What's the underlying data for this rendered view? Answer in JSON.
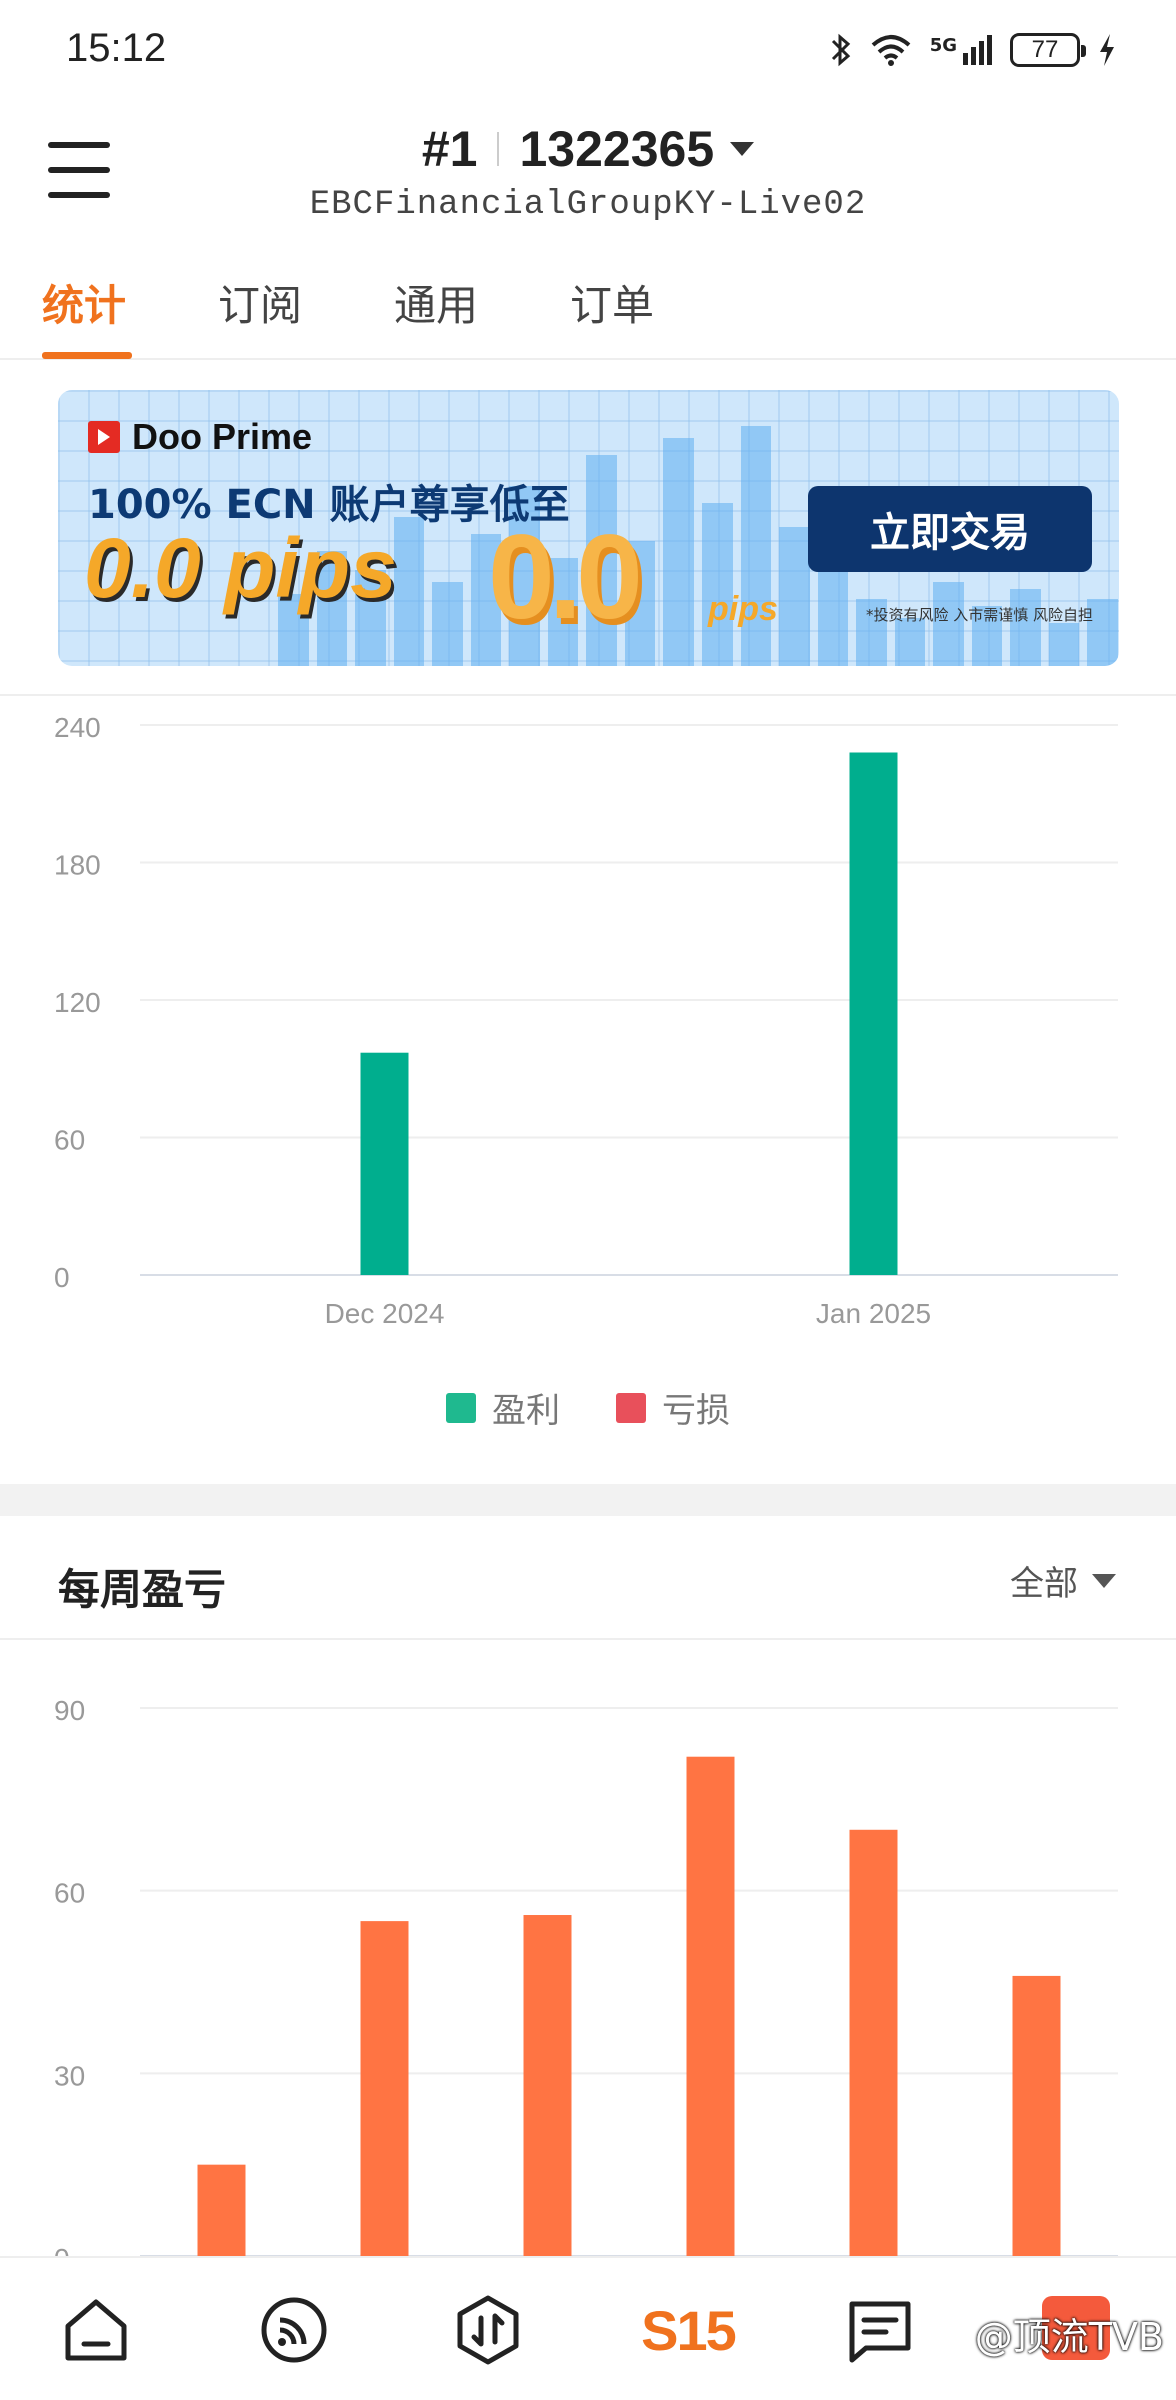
{
  "status_bar": {
    "time": "15:12",
    "network": "5G",
    "battery": "77"
  },
  "header": {
    "account_number": "#1",
    "account_id": "1322365",
    "server": "EBCFinancialGroupKY-Live02"
  },
  "tabs": [
    {
      "label": "统计",
      "active": true
    },
    {
      "label": "订阅",
      "active": false
    },
    {
      "label": "通用",
      "active": false
    },
    {
      "label": "订单",
      "active": false
    }
  ],
  "banner": {
    "brand": "Doo Prime",
    "line1": "100% ECN 账户尊享低至",
    "line2": "0.0 pips",
    "big_value": "0.0",
    "small_pips": "pips",
    "cta": "立即交易",
    "disclaimer": "*投资有风险 入市需谨慎 风险自担"
  },
  "monthly_chart": {
    "chart_data": {
      "type": "bar",
      "categories": [
        "Dec 2024",
        "Jan 2025"
      ],
      "series": [
        {
          "name": "盈利",
          "values": [
            97,
            228
          ],
          "color": "#00ae8e"
        },
        {
          "name": "亏损",
          "values": [
            0,
            0
          ],
          "color": "#e8505b"
        }
      ],
      "yticks": [
        "240",
        "180",
        "120",
        "60",
        "0"
      ],
      "ylim": [
        0,
        240
      ],
      "grid": true,
      "legend": "bottom-center"
    }
  },
  "weekly": {
    "title": "每周盈亏",
    "filter": "全部",
    "chart_data": {
      "type": "bar",
      "categories": [
        "",
        "",
        "",
        "",
        "",
        ""
      ],
      "values": [
        15,
        55,
        56,
        82,
        70,
        46
      ],
      "color": "#ff7443",
      "yticks": [
        "90",
        "60",
        "30",
        "0"
      ],
      "ylim": [
        0,
        90
      ],
      "grid": true
    }
  },
  "bottom_nav": {
    "items": [
      "home-icon",
      "feed-icon",
      "trade-icon",
      "s15-icon",
      "message-icon"
    ],
    "s15_label": "S15",
    "watermark": "@顶流TVB"
  }
}
